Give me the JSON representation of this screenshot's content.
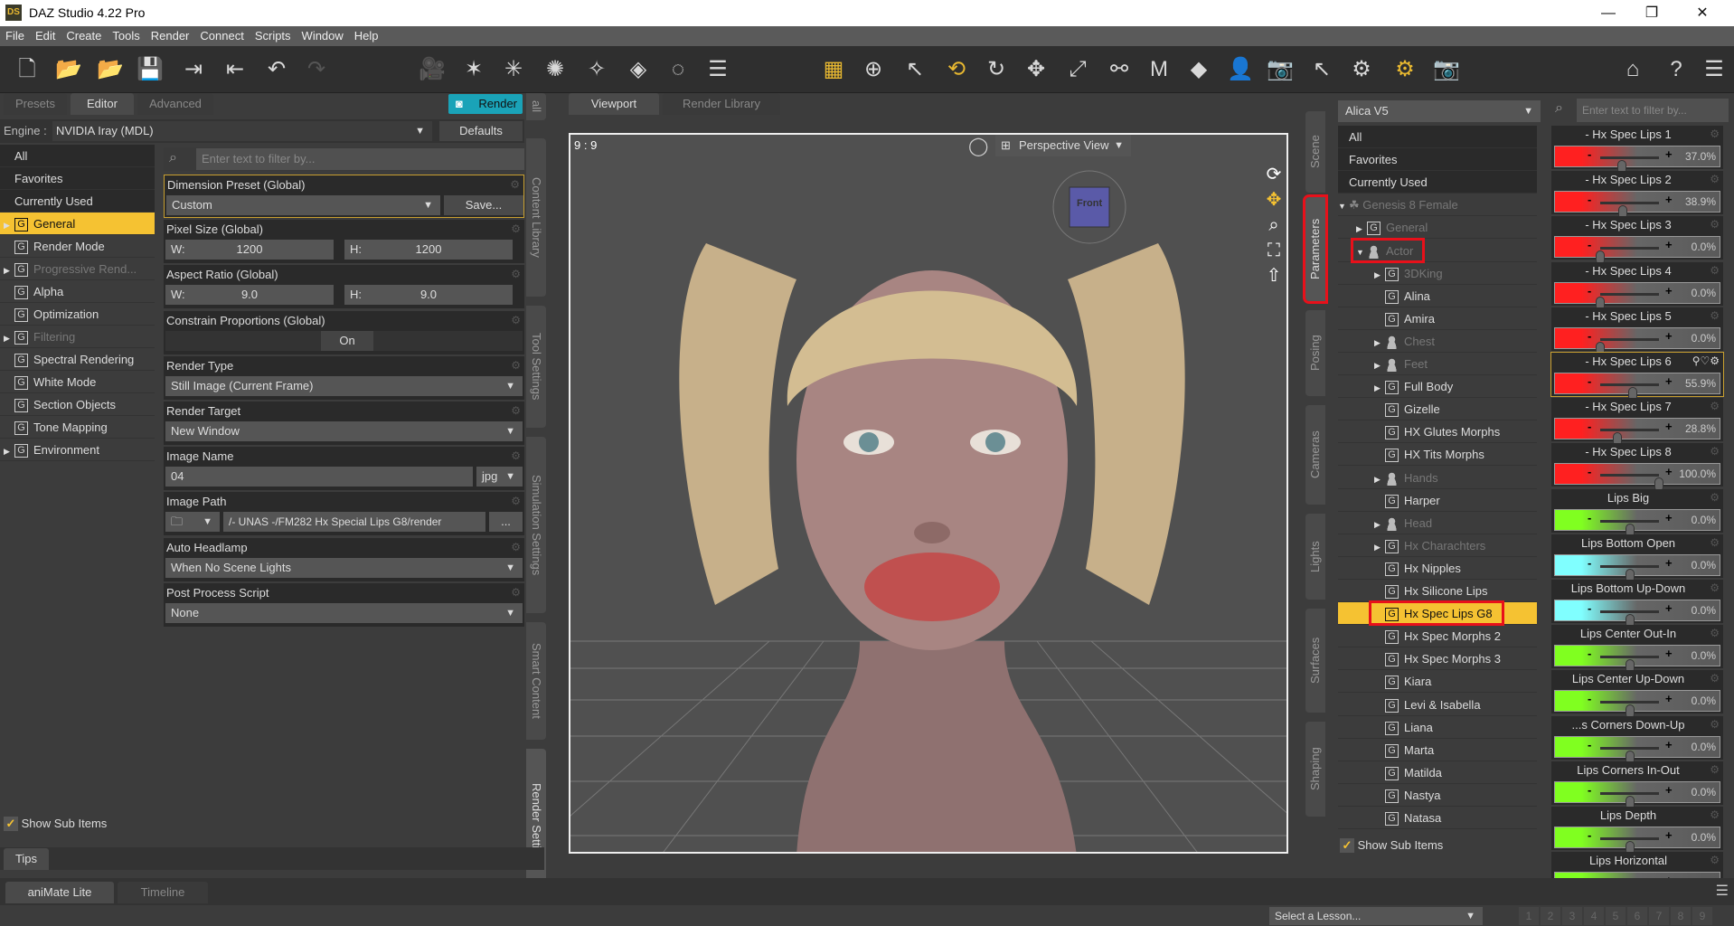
{
  "title": "DAZ Studio 4.22 Pro",
  "logo": "DS",
  "window_controls": [
    "—",
    "❐",
    "✕"
  ],
  "menu": [
    "File",
    "Edit",
    "Create",
    "Tools",
    "Render",
    "Connect",
    "Scripts",
    "Window",
    "Help"
  ],
  "left_panel": {
    "tabs": [
      "Presets",
      "Editor",
      "Advanced"
    ],
    "active_tab": "Editor",
    "render_button": "Render",
    "engine_label": "Engine :",
    "engine_value": "NVIDIA Iray (MDL)",
    "defaults_button": "Defaults",
    "filter_placeholder": "Enter text to filter by...",
    "categories": [
      {
        "label": "All",
        "type": "plain"
      },
      {
        "label": "Favorites",
        "type": "plain"
      },
      {
        "label": "Currently Used",
        "type": "plain"
      },
      {
        "label": "General",
        "type": "group",
        "expandable": true,
        "selected": true
      },
      {
        "label": "Render Mode",
        "type": "group"
      },
      {
        "label": "Progressive Rend...",
        "type": "group",
        "expandable": true,
        "dim": true
      },
      {
        "label": "Alpha",
        "type": "group"
      },
      {
        "label": "Optimization",
        "type": "group"
      },
      {
        "label": "Filtering",
        "type": "group",
        "expandable": true,
        "dim": true
      },
      {
        "label": "Spectral Rendering",
        "type": "group"
      },
      {
        "label": "White Mode",
        "type": "group"
      },
      {
        "label": "Section Objects",
        "type": "group"
      },
      {
        "label": "Tone Mapping",
        "type": "group"
      },
      {
        "label": "Environment",
        "type": "group",
        "expandable": true
      }
    ],
    "show_sub_items": "Show Sub Items",
    "properties": {
      "dimension_preset": {
        "label": "Dimension Preset (Global)",
        "value": "Custom",
        "save": "Save..."
      },
      "pixel_size": {
        "label": "Pixel Size (Global)",
        "w_label": "W:",
        "w": "1200",
        "h_label": "H:",
        "h": "1200"
      },
      "aspect_ratio": {
        "label": "Aspect Ratio (Global)",
        "w_label": "W:",
        "w": "9.0",
        "h_label": "H:",
        "h": "9.0"
      },
      "constrain": {
        "label": "Constrain Proportions (Global)",
        "value": "On"
      },
      "render_type": {
        "label": "Render Type",
        "value": "Still Image (Current Frame)"
      },
      "render_target": {
        "label": "Render Target",
        "value": "New Window"
      },
      "image_name": {
        "label": "Image Name",
        "value": "04",
        "ext": "jpg"
      },
      "image_path": {
        "label": "Image Path",
        "value": "/- UNAS -/FM282 Hx Special Lips G8/render",
        "browse": "..."
      },
      "auto_headlamp": {
        "label": "Auto Headlamp",
        "value": "When No Scene Lights"
      },
      "post_process": {
        "label": "Post Process Script",
        "value": "None"
      }
    },
    "side_tabs": [
      "all",
      "Content Library",
      "Tool Settings",
      "Simulation Settings",
      "Smart Content",
      "Render Settings"
    ]
  },
  "viewport": {
    "tabs": [
      "Viewport",
      "Render Library"
    ],
    "aspect": "9 : 9",
    "camera": "Perspective View",
    "cube_label": "Front"
  },
  "right_tabs": [
    "Scene",
    "Parameters",
    "Posing",
    "Cameras",
    "Lights",
    "Surfaces",
    "Shaping"
  ],
  "parameters": {
    "node": "Alica V5",
    "filter_placeholder": "Enter text to filter by...",
    "tree": [
      {
        "label": "All",
        "type": "plain"
      },
      {
        "label": "Favorites",
        "type": "plain"
      },
      {
        "label": "Currently Used",
        "type": "plain"
      },
      {
        "label": "Genesis 8 Female",
        "type": "figure",
        "level": 0,
        "expanded": true,
        "dim": true
      },
      {
        "label": "General",
        "type": "group",
        "level": 1,
        "expandable": true,
        "dim": true
      },
      {
        "label": "Actor",
        "type": "person",
        "level": 1,
        "expanded": true,
        "dim": true,
        "highlight": true
      },
      {
        "label": "3DKing",
        "type": "group",
        "level": 2,
        "expandable": true,
        "dim": true
      },
      {
        "label": "Alina",
        "type": "group",
        "level": 2
      },
      {
        "label": "Amira",
        "type": "group",
        "level": 2
      },
      {
        "label": "Chest",
        "type": "person",
        "level": 2,
        "expandable": true,
        "dim": true
      },
      {
        "label": "Feet",
        "type": "person",
        "level": 2,
        "expandable": true,
        "dim": true
      },
      {
        "label": "Full Body",
        "type": "group",
        "level": 2,
        "expandable": true
      },
      {
        "label": "Gizelle",
        "type": "group",
        "level": 2
      },
      {
        "label": "HX Glutes Morphs",
        "type": "group",
        "level": 2
      },
      {
        "label": "HX Tits Morphs",
        "type": "group",
        "level": 2
      },
      {
        "label": "Hands",
        "type": "person",
        "level": 2,
        "expandable": true,
        "dim": true
      },
      {
        "label": "Harper",
        "type": "group",
        "level": 2
      },
      {
        "label": "Head",
        "type": "person",
        "level": 2,
        "expandable": true,
        "dim": true
      },
      {
        "label": "Hx Charachters",
        "type": "group",
        "level": 2,
        "expandable": true,
        "dim": true
      },
      {
        "label": "Hx Nipples",
        "type": "group",
        "level": 2
      },
      {
        "label": "Hx Silicone Lips",
        "type": "group",
        "level": 2
      },
      {
        "label": "Hx Spec Lips G8",
        "type": "group",
        "level": 2,
        "selected": true,
        "highlight": true
      },
      {
        "label": "Hx Spec Morphs 2",
        "type": "group",
        "level": 2
      },
      {
        "label": "Hx Spec Morphs 3",
        "type": "group",
        "level": 2
      },
      {
        "label": "Kiara",
        "type": "group",
        "level": 2
      },
      {
        "label": "Levi & Isabella",
        "type": "group",
        "level": 2
      },
      {
        "label": "Liana",
        "type": "group",
        "level": 2
      },
      {
        "label": "Marta",
        "type": "group",
        "level": 2
      },
      {
        "label": "Matilda",
        "type": "group",
        "level": 2
      },
      {
        "label": "Nastya",
        "type": "group",
        "level": 2
      },
      {
        "label": "Natasa",
        "type": "group",
        "level": 2
      }
    ],
    "show_sub_items": "Show Sub Items",
    "sliders": [
      {
        "name": "- Hx Spec Lips 1",
        "value": "37.0%",
        "pct": 37,
        "min": 0,
        "max": 100,
        "color": "#ff2020"
      },
      {
        "name": "- Hx Spec Lips 2",
        "value": "38.9%",
        "pct": 38.9,
        "min": 0,
        "max": 100,
        "color": "#ff2020"
      },
      {
        "name": "- Hx Spec Lips 3",
        "value": "0.0%",
        "pct": 0,
        "min": 0,
        "max": 100,
        "color": "#ff2020"
      },
      {
        "name": "- Hx Spec Lips 4",
        "value": "0.0%",
        "pct": 0,
        "min": 0,
        "max": 100,
        "color": "#ff2020"
      },
      {
        "name": "- Hx Spec Lips 5",
        "value": "0.0%",
        "pct": 0,
        "min": 0,
        "max": 100,
        "color": "#ff2020"
      },
      {
        "name": "- Hx Spec Lips 6",
        "value": "55.9%",
        "pct": 55.9,
        "min": 0,
        "max": 100,
        "color": "#ff2020",
        "active": true
      },
      {
        "name": "- Hx Spec Lips 7",
        "value": "28.8%",
        "pct": 28.8,
        "min": 0,
        "max": 100,
        "color": "#ff2020"
      },
      {
        "name": "- Hx Spec Lips 8",
        "value": "100.0%",
        "pct": 100,
        "min": 0,
        "max": 100,
        "color": "#ff2020"
      },
      {
        "name": "Lips Big",
        "value": "0.0%",
        "pct": 0,
        "min": -100,
        "max": 100,
        "color": "#80ff20"
      },
      {
        "name": "Lips Bottom Open",
        "value": "0.0%",
        "pct": 0,
        "min": -100,
        "max": 100,
        "color": "#80ffff"
      },
      {
        "name": "Lips Bottom Up-Down",
        "value": "0.0%",
        "pct": 0,
        "min": -100,
        "max": 100,
        "color": "#80ffff"
      },
      {
        "name": "Lips Center Out-In",
        "value": "0.0%",
        "pct": 0,
        "min": -100,
        "max": 100,
        "color": "#80ff20"
      },
      {
        "name": "Lips Center Up-Down",
        "value": "0.0%",
        "pct": 0,
        "min": -100,
        "max": 100,
        "color": "#80ff20"
      },
      {
        "name": "...s Corners Down-Up",
        "value": "0.0%",
        "pct": 0,
        "min": -100,
        "max": 100,
        "color": "#80ff20"
      },
      {
        "name": "Lips Corners In-Out",
        "value": "0.0%",
        "pct": 0,
        "min": -100,
        "max": 100,
        "color": "#80ff20"
      },
      {
        "name": "Lips Depth",
        "value": "0.0%",
        "pct": 0,
        "min": -100,
        "max": 100,
        "color": "#80ff20"
      },
      {
        "name": "Lips Horizontal",
        "value": "",
        "pct": 0,
        "min": -100,
        "max": 100,
        "color": "#80ff20"
      }
    ]
  },
  "bottom": {
    "tips": "Tips",
    "tabs": [
      "aniMate Lite",
      "Timeline"
    ],
    "lesson": "Select a Lesson...",
    "pages": [
      "1",
      "2",
      "3",
      "4",
      "5",
      "6",
      "7",
      "8",
      "9"
    ]
  },
  "colors": {
    "accent": "#f5c232",
    "render": "#1aa3b8",
    "highlight_box": "#e8101a"
  }
}
